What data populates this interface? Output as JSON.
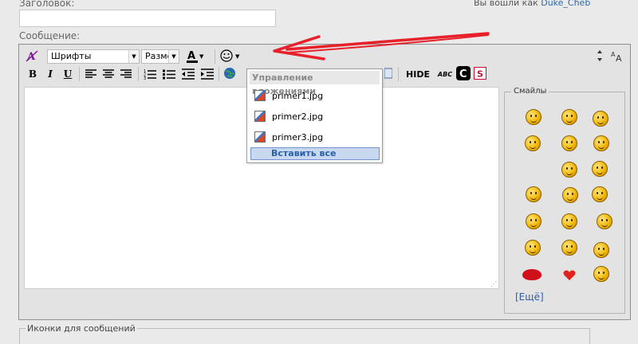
{
  "header": {
    "title_label": "Заголовок:",
    "logged_prefix": "Вы вошли как",
    "username": "Duke_Cheb",
    "message_label": "Сообщение:"
  },
  "toolbar": {
    "font_select": "Шрифты",
    "size_select": "Разме",
    "hide_label": "HIDE",
    "abc_label": "ABC"
  },
  "attachments_menu": {
    "title": "Управление вложениями",
    "items": [
      "primer1.jpg",
      "primer2.jpg",
      "primer3.jpg"
    ],
    "insert_all": "Вставить все"
  },
  "smiles": {
    "title": "Смайлы",
    "more": "[Ещё]"
  },
  "footer": {
    "icons_legend": "Иконки для сообщений"
  },
  "colors": {
    "arrow": "#e8202a",
    "link": "#2a5fa8"
  }
}
